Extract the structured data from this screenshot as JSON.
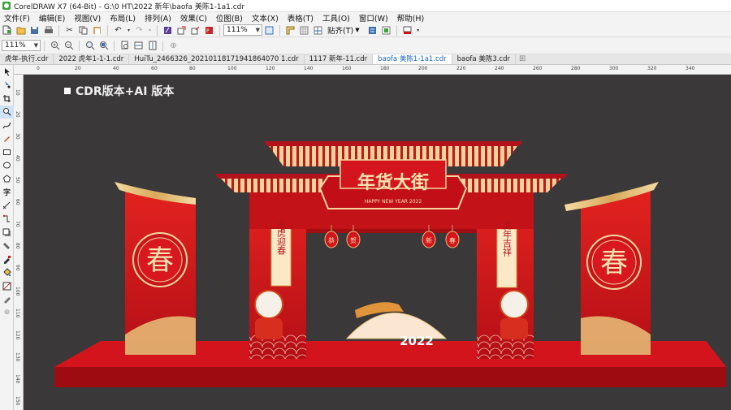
{
  "window": {
    "title": "CorelDRAW X7 (64-Bit) - G:\\0 HT\\2022 新年\\baofa 美陈1-1a1.cdr"
  },
  "menu": {
    "items": [
      "文件(F)",
      "编辑(E)",
      "视图(V)",
      "布局(L)",
      "排列(A)",
      "效果(C)",
      "位图(B)",
      "文本(X)",
      "表格(T)",
      "工具(O)",
      "窗口(W)",
      "帮助(H)"
    ]
  },
  "toolbar": {
    "zoom_value": "111%",
    "snap_label": "贴齐(T)"
  },
  "property_bar": {
    "zoom_value": "111%"
  },
  "tabs": [
    {
      "label": "虎年-执行.cdr",
      "active": false
    },
    {
      "label": "2022 虎年1-1-1.cdr",
      "active": false
    },
    {
      "label": "HuiTu_2466326_20210118171941864070 1.cdr",
      "active": false
    },
    {
      "label": "1117 新年-11.cdr",
      "active": false
    },
    {
      "label": "baofa 美陈1-1a1.cdr",
      "active": true
    },
    {
      "label": "baofa 美陈3.cdr",
      "active": false
    }
  ],
  "ruler": {
    "h_labels": [
      "0",
      "20",
      "40",
      "60",
      "80",
      "100",
      "120",
      "140",
      "160",
      "180",
      "200",
      "220",
      "240",
      "260",
      "280",
      "300",
      "320",
      "340"
    ],
    "v_labels": [
      "10",
      "20",
      "30",
      "40",
      "50",
      "60",
      "70",
      "80",
      "90",
      "100",
      "110",
      "120",
      "130",
      "140",
      "150"
    ]
  },
  "canvas": {
    "version_label": "CDR版本+AI 版本",
    "sign_main": "年货大街",
    "sign_sub": "HAPPY NEW YEAR 2022",
    "left_couplet": "金虎迎春",
    "right_couplet": "虎年吉祥",
    "lanterns": [
      "恭",
      "贺",
      "新",
      "春"
    ],
    "spring_char": "春",
    "year_text": "2022"
  },
  "colors": {
    "canvas_bg": "#3a3838",
    "festive_red": "#d0121b",
    "dark_red": "#9e0c12",
    "gold": "#e8c27a",
    "accent_blue": "#1a64c8"
  }
}
